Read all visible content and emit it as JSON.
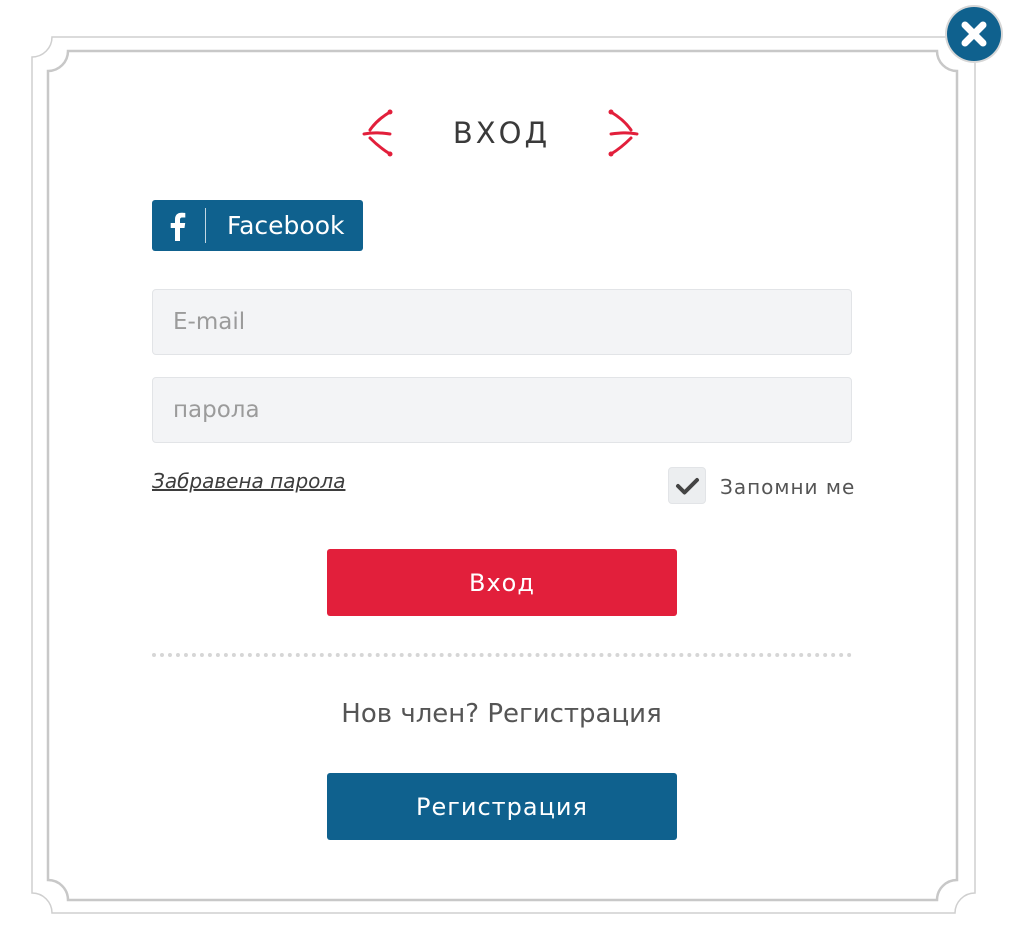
{
  "dialog": {
    "title": "ВХОД",
    "close_icon": "close-icon",
    "accent_color": "#e21f3b",
    "brand_color": "#0f618e"
  },
  "social": {
    "facebook_label": "Facebook",
    "facebook_icon": "facebook-icon"
  },
  "form": {
    "email_placeholder": "E-mail",
    "email_value": "",
    "password_placeholder": "парола",
    "password_value": "",
    "forgot_link": "Забравена парола",
    "remember_label": "Запомни ме",
    "remember_checked": true,
    "login_button": "Вход"
  },
  "register": {
    "prompt": "Нов член? Регистрация",
    "button": "Регистрация"
  }
}
